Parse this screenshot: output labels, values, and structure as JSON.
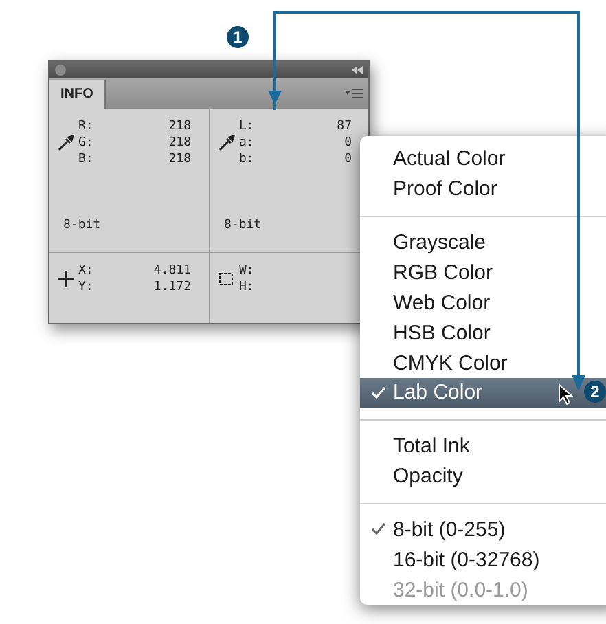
{
  "callouts": [
    {
      "label": "1"
    },
    {
      "label": "2"
    }
  ],
  "panel": {
    "tab": {
      "label": "INFO",
      "selected": true
    },
    "top": [
      {
        "kind": "eyedropper",
        "rows": [
          {
            "label": "R:",
            "value": "218"
          },
          {
            "label": "G:",
            "value": "218"
          },
          {
            "label": "B:",
            "value": "218"
          }
        ],
        "footer": "8-bit"
      },
      {
        "kind": "eyedropper",
        "rows": [
          {
            "label": "L:",
            "value": "87"
          },
          {
            "label": "a:",
            "value": "0"
          },
          {
            "label": "b:",
            "value": "0"
          }
        ],
        "footer": "8-bit"
      }
    ],
    "bottom": [
      {
        "kind": "crosshair",
        "rows": [
          {
            "label": "X:",
            "value": "4.811"
          },
          {
            "label": "Y:",
            "value": "1.172"
          }
        ]
      },
      {
        "kind": "marquee",
        "rows": [
          {
            "label": "W:",
            "value": ""
          },
          {
            "label": "H:",
            "value": ""
          }
        ]
      }
    ]
  },
  "menu": {
    "items": [
      {
        "kind": "item",
        "label": "Actual Color",
        "checked": false,
        "selected": false,
        "disabled": false
      },
      {
        "kind": "item",
        "label": "Proof Color",
        "checked": false,
        "selected": false,
        "disabled": false
      },
      {
        "kind": "separator"
      },
      {
        "kind": "item",
        "label": "Grayscale",
        "checked": false,
        "selected": false,
        "disabled": false
      },
      {
        "kind": "item",
        "label": "RGB Color",
        "checked": false,
        "selected": false,
        "disabled": false
      },
      {
        "kind": "item",
        "label": "Web Color",
        "checked": false,
        "selected": false,
        "disabled": false
      },
      {
        "kind": "item",
        "label": "HSB Color",
        "checked": false,
        "selected": false,
        "disabled": false
      },
      {
        "kind": "item",
        "label": "CMYK Color",
        "checked": false,
        "selected": false,
        "disabled": false
      },
      {
        "kind": "item",
        "label": "Lab Color",
        "checked": true,
        "selected": true,
        "disabled": false
      },
      {
        "kind": "separator"
      },
      {
        "kind": "item",
        "label": "Total Ink",
        "checked": false,
        "selected": false,
        "disabled": false
      },
      {
        "kind": "item",
        "label": "Opacity",
        "checked": false,
        "selected": false,
        "disabled": false
      },
      {
        "kind": "separator"
      },
      {
        "kind": "item",
        "label": "8-bit (0-255)",
        "checked": true,
        "selected": false,
        "disabled": false
      },
      {
        "kind": "item",
        "label": "16-bit (0-32768)",
        "checked": false,
        "selected": false,
        "disabled": false
      },
      {
        "kind": "item",
        "label": "32-bit (0.0-1.0)",
        "checked": false,
        "selected": false,
        "disabled": true
      }
    ]
  }
}
